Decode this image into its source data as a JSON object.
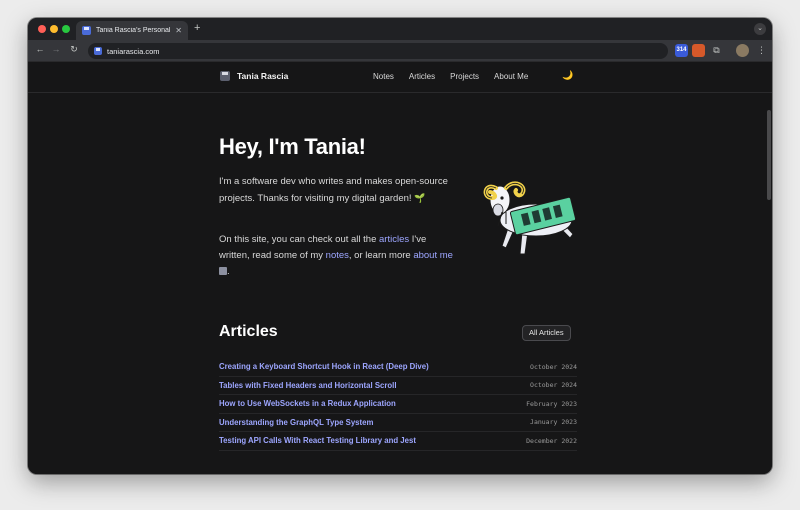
{
  "browser": {
    "tab_title": "Tania Rascia's Personal Website",
    "tab_close": "✕",
    "new_tab": "+",
    "url": "taniarascia.com",
    "nav": {
      "back": "←",
      "forward": "→",
      "reload": "↻"
    },
    "extensions": [
      "314",
      "",
      "⧉",
      "",
      "⋮"
    ]
  },
  "site": {
    "brand": "Tania Rascia",
    "nav_links": [
      "Notes",
      "Articles",
      "Projects",
      "About Me"
    ],
    "theme_toggle": "🌙"
  },
  "hero": {
    "title": "Hey, I'm Tania!",
    "p1_text": "I'm a software dev who writes and makes open-source projects. Thanks for visiting my digital garden!",
    "p1_emoji": "🌱",
    "p2_before": "On this site, you can check out all the",
    "p2_link1": "articles",
    "p2_mid1": "I've written, read some of my",
    "p2_link2": "notes",
    "p2_mid2": ", or learn more",
    "p2_link3": "about me",
    "p2_end": "."
  },
  "articles_section": {
    "title": "Articles",
    "all_button": "All Articles",
    "items": [
      {
        "title": "Creating a Keyboard Shortcut Hook in React (Deep Dive)",
        "date": "October 2024"
      },
      {
        "title": "Tables with Fixed Headers and Horizontal Scroll",
        "date": "October 2024"
      },
      {
        "title": "How to Use WebSockets in a Redux Application",
        "date": "February 2023"
      },
      {
        "title": "Understanding the GraphQL Type System",
        "date": "January 2023"
      },
      {
        "title": "Testing API Calls With React Testing Library and Jest",
        "date": "December 2022"
      }
    ]
  },
  "colors": {
    "page_bg": "#161617",
    "accent_link": "#9da6ff",
    "ram_green": "#5ad1a0"
  }
}
